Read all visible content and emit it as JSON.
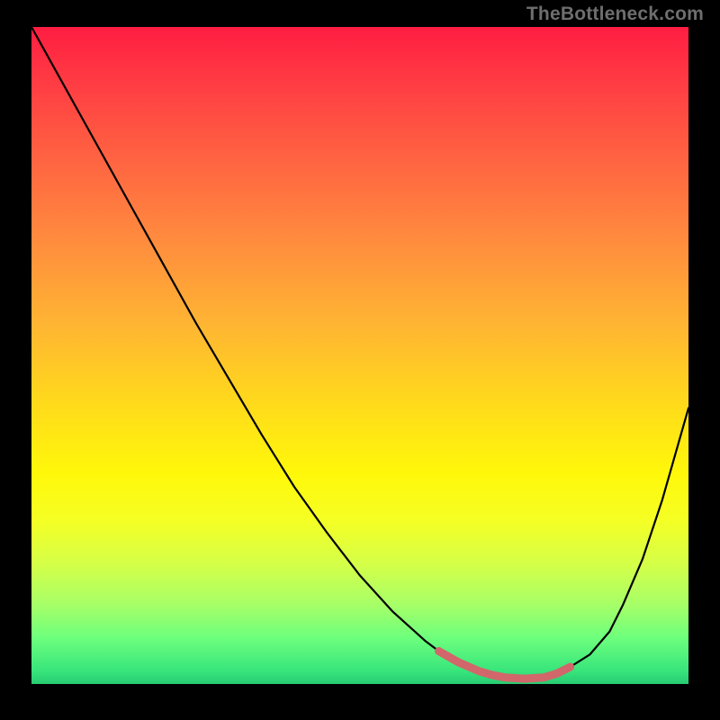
{
  "watermark": "TheBottleneck.com",
  "colors": {
    "background": "#000000",
    "curve": "#000000",
    "marker": "#d1676a"
  },
  "chart_data": {
    "type": "line",
    "title": "",
    "xlabel": "",
    "ylabel": "",
    "xlim": [
      0,
      100
    ],
    "ylim": [
      0,
      100
    ],
    "grid": false,
    "legend": false,
    "series": [
      {
        "name": "bottleneck_curve",
        "x": [
          0,
          5,
          10,
          15,
          20,
          25,
          30,
          35,
          40,
          45,
          50,
          55,
          60,
          62,
          65,
          68,
          70,
          72,
          75,
          78,
          80,
          82,
          85,
          88,
          90,
          93,
          96,
          100
        ],
        "values": [
          100,
          91,
          82,
          73,
          64,
          55,
          46.5,
          38,
          30,
          23,
          16.5,
          11,
          6.5,
          5,
          3.3,
          2,
          1.4,
          1,
          0.8,
          1,
          1.6,
          2.6,
          4.5,
          8,
          12,
          19,
          28,
          42
        ]
      },
      {
        "name": "optimal_range_marker",
        "x": [
          62,
          65,
          68,
          70,
          72,
          75,
          78,
          80,
          82
        ],
        "values": [
          5,
          3.3,
          2,
          1.4,
          1,
          0.8,
          1,
          1.6,
          2.6
        ]
      }
    ]
  }
}
